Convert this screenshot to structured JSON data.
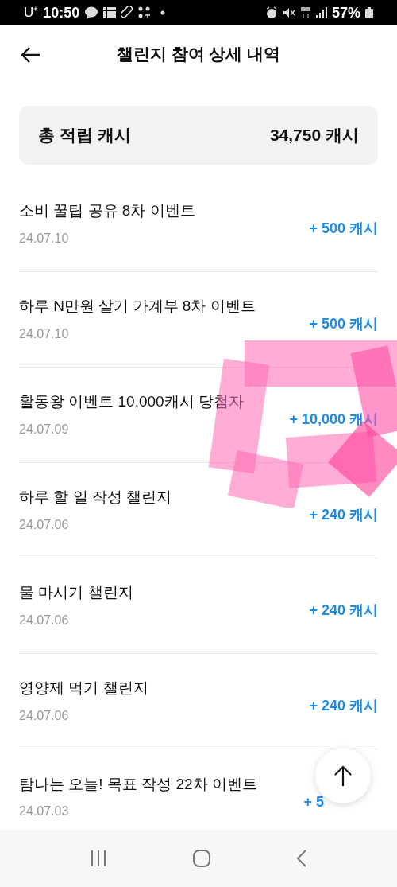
{
  "status_bar": {
    "carrier": "U⁺",
    "time": "10:50",
    "battery": "57%"
  },
  "header": {
    "title": "챌린지 참여 상세 내역"
  },
  "total": {
    "label": "총 적립 캐시",
    "value": "34,750 캐시"
  },
  "entries": [
    {
      "title": "소비 꿀팁 공유 8차 이벤트",
      "date": "24.07.10",
      "amount": "+ 500 캐시"
    },
    {
      "title": "하루 N만원 살기 가계부 8차 이벤트",
      "date": "24.07.10",
      "amount": "+ 500 캐시"
    },
    {
      "title": "활동왕 이벤트 10,000캐시 당첨자",
      "date": "24.07.09",
      "amount": "+ 10,000 캐시"
    },
    {
      "title": "하루 할 일 작성 챌린지",
      "date": "24.07.06",
      "amount": "+ 240 캐시"
    },
    {
      "title": "물 마시기 챌린지",
      "date": "24.07.06",
      "amount": "+ 240 캐시"
    },
    {
      "title": "영양제 먹기 챌린지",
      "date": "24.07.06",
      "amount": "+ 240 캐시"
    },
    {
      "title": "탐나는 오늘! 목표 작성 22차 이벤트",
      "date": "24.07.03",
      "amount": "+ 5"
    }
  ]
}
